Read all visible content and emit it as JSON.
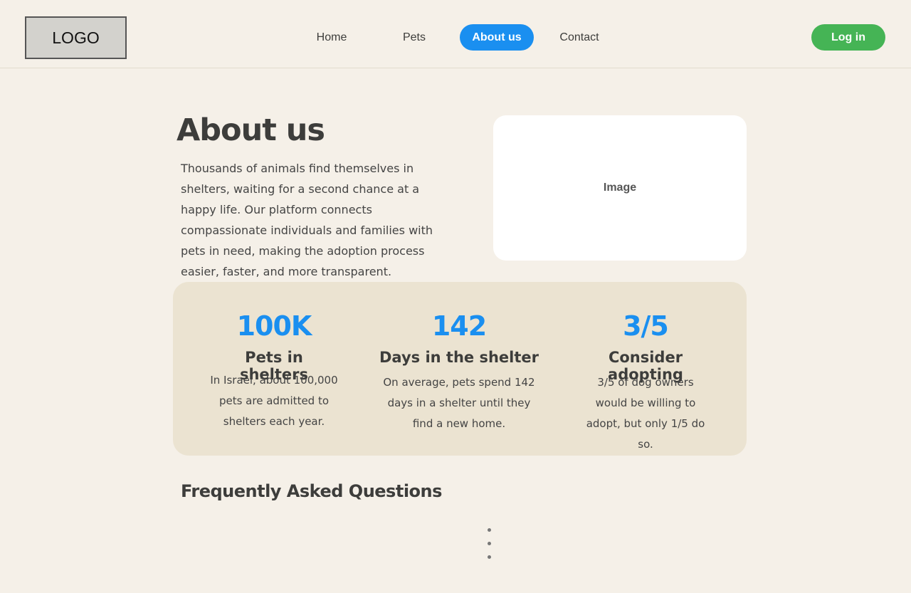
{
  "header": {
    "logo": "LOGO",
    "nav": [
      {
        "label": "Home",
        "active": false
      },
      {
        "label": "Pets",
        "active": false
      },
      {
        "label": "About us",
        "active": true
      },
      {
        "label": "Contact",
        "active": false
      }
    ],
    "login_label": "Log in"
  },
  "intro": {
    "title": "About us",
    "text": "Thousands of animals find themselves in shelters, waiting for a second chance at a happy life. Our platform connects compassionate individuals and families with pets in need, making the adoption process easier, faster, and more transparent.",
    "image_label": "Image"
  },
  "stats": [
    {
      "value": "100K",
      "label": "Pets in shelters",
      "description": "In Israel, about 100,000 pets are admitted to shelters each year."
    },
    {
      "value": "142",
      "label": "Days in the shelter",
      "description": "On average, pets spend 142 days in a shelter until they find a new home."
    },
    {
      "value": "3/5",
      "label": "Consider adopting",
      "description": "3/5 of dog owners would be willing to adopt, but only 1/5 do so."
    }
  ],
  "faq": {
    "title": "Frequently Asked Questions",
    "loading": "loading-indicator"
  },
  "colors": {
    "background": "#f5f0e8",
    "accent_blue": "#1a8ff0",
    "login_green": "#45b455",
    "stats_panel": "#ebe3d1",
    "text_dark": "#3d3d3b"
  }
}
